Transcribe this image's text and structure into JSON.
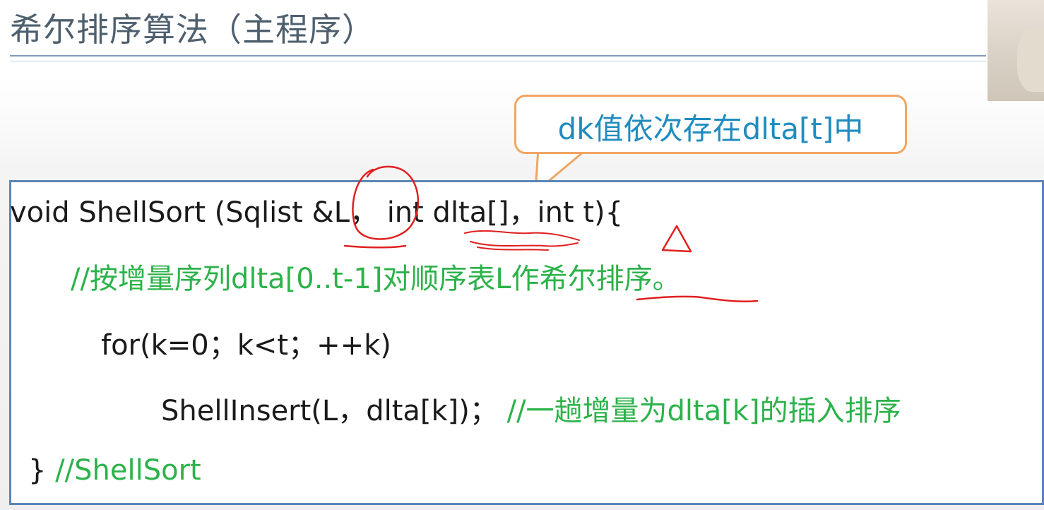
{
  "slide": {
    "title": "希尔排序算法（主程序）",
    "callout": "dk值依次存在dlta[t]中"
  },
  "code": {
    "line1": "void ShellSort (Sqlist &L， int dlta[]，int t){",
    "line2_comment": "//按增量序列dlta[0..t-1]对顺序表L作希尔排序。",
    "line3": "for(k=0；k<t；++k)",
    "line4_code": "ShellInsert(L，dlta[k])；",
    "line4_comment": "//一趟增量为dlta[k]的插入排序",
    "line5_brace": "}",
    "line5_comment": "//ShellSort"
  },
  "colors": {
    "title": "#4e5f6e",
    "rule": "#7f9bbd",
    "callout_border": "#f0a563",
    "callout_text": "#1f8cbf",
    "code_border": "#5b86b8",
    "comment": "#2cb24a",
    "ink": "#e02020"
  }
}
